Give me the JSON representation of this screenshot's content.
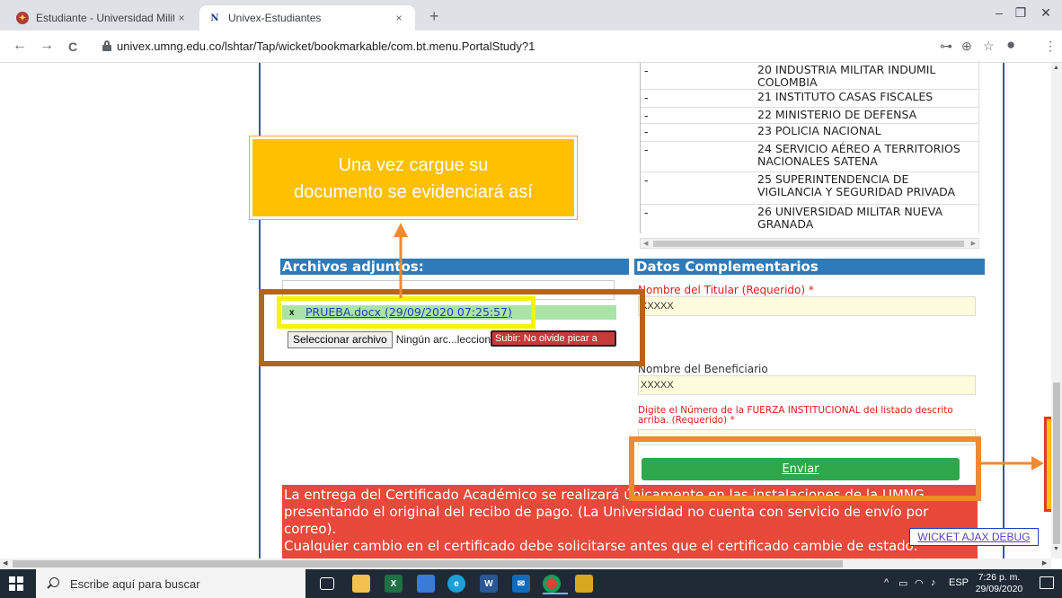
{
  "browser": {
    "tabs": [
      {
        "title": "Estudiante - Universidad Militar N",
        "icon": "umng-shield-icon",
        "close": "×"
      },
      {
        "title": "Univex-Estudiantes",
        "icon": "univex-logo-icon",
        "close": "×"
      }
    ],
    "new_tab": "+",
    "window_controls": {
      "minimize": "–",
      "restore": "❐",
      "close": "✕"
    },
    "nav": {
      "back": "←",
      "forward": "→",
      "reload": "C"
    },
    "url": "univex.umng.edu.co/lshtar/Tap/wicket/bookmarkable/com.bt.menu.PortalStudy?1",
    "addr_icons": {
      "key": "⊶",
      "zoom": "⊕",
      "bookmark": "☆",
      "profile": "●",
      "menu": "⋮"
    }
  },
  "institutions": [
    {
      "dash": "-",
      "name": "20 INDUSTRIA MILITAR INDUMIL COLOMBIA"
    },
    {
      "dash": "-",
      "name": "21 INSTITUTO CASAS FISCALES"
    },
    {
      "dash": "-",
      "name": "22 MINISTERIO DE DEFENSA"
    },
    {
      "dash": "-",
      "name": "23 POLICIA NACIONAL"
    },
    {
      "dash": "-",
      "name": "24 SERVICIO AÉREO A TERRITORIOS NACIONALES SATENA"
    },
    {
      "dash": "-",
      "name": "25 SUPERINTENDENCIA DE VIGILANCIA Y SEGURIDAD PRIVADA"
    },
    {
      "dash": "-",
      "name": "26 UNIVERSIDAD MILITAR NUEVA GRANADA"
    }
  ],
  "attachments": {
    "header": "Archivos adjuntos:",
    "file_x": "x",
    "file_name": "PRUEBA.docx (29/09/2020 07:25:57)",
    "select_button": "Seleccionar archivo",
    "no_file": "Ningún arc...leccionado",
    "upload_button": "Subir: No olvide picar a"
  },
  "complementary": {
    "header": "Datos Complementarios",
    "titular_label": "Nombre del Titular (Requerido) *",
    "titular_value": "XXXXX",
    "beneficiary_label": "Nombre del Beneficiario",
    "beneficiary_value": "XXXXX",
    "force_label": "Digite el Número de la FUERZA INSTITUCIONAL del listado descrito arriba. (Requerido) *",
    "send_button": "Enviar"
  },
  "notice": {
    "line1": "La entrega del Certificado Académico se realizará únicamente en las instalaciones de la UMNG, presentando el original del recibo de pago. (La Universidad no cuenta con servicio de envío por correo).",
    "line2": "Cualquier cambio en el certificado debe solicitarse antes que el certificado cambie de estado."
  },
  "debug_link": "WICKET AJAX DEBUG",
  "callout": {
    "line1": "Una vez cargue su",
    "line2": "documento se evidenciará así"
  },
  "colors": {
    "callout": "#ffc000",
    "highlight_brown": "#b5641c",
    "highlight_yellow": "#f5f300",
    "highlight_orange": "#f08a30",
    "section_header": "#2f7bb8",
    "notice": "#e8493a",
    "send_button": "#2fa84b"
  },
  "taskbar": {
    "search_placeholder": "Escribe aquí para buscar",
    "apps": [
      "task-view-icon",
      "file-explorer-icon",
      "excel-icon",
      "store-icon",
      "edge-icon",
      "word-icon",
      "mail-icon",
      "chrome-icon",
      "keepass-icon"
    ],
    "tray_lang": "ESP",
    "time": "7:26 p. m.",
    "date": "29/09/2020"
  }
}
